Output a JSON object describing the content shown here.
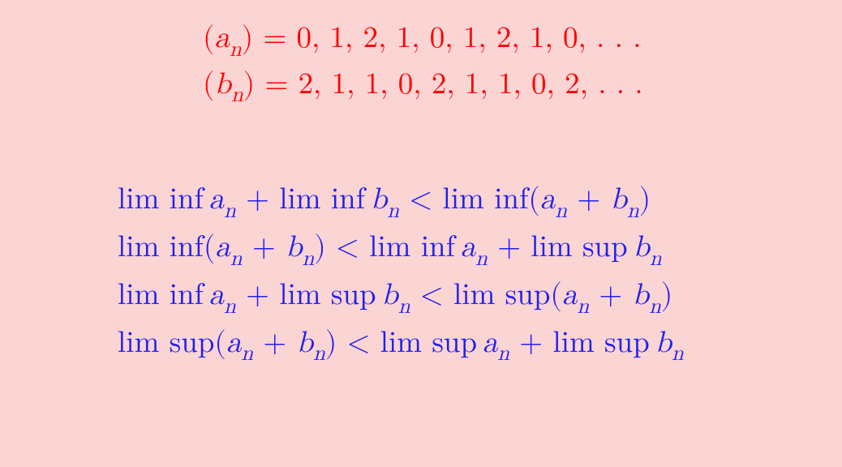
{
  "sequences": {
    "a": {
      "label_open": "(",
      "var": "a",
      "sub": "n",
      "label_close": ")",
      "eq": " = ",
      "values": "0, 1, 2, 1, 0, 1, 2, 1, 0, . . ."
    },
    "b": {
      "label_open": "(",
      "var": "b",
      "sub": "n",
      "label_close": ")",
      "eq": " = ",
      "values": "2, 1, 1, 0, 2, 1, 1, 0, 2, . . ."
    }
  },
  "ops": {
    "liminf": "lim inf",
    "limsup": "lim sup",
    "lt": " < ",
    "plus": " + "
  },
  "vars": {
    "a": "a",
    "b": "b",
    "n": "n",
    "open": "(",
    "close": ")"
  }
}
